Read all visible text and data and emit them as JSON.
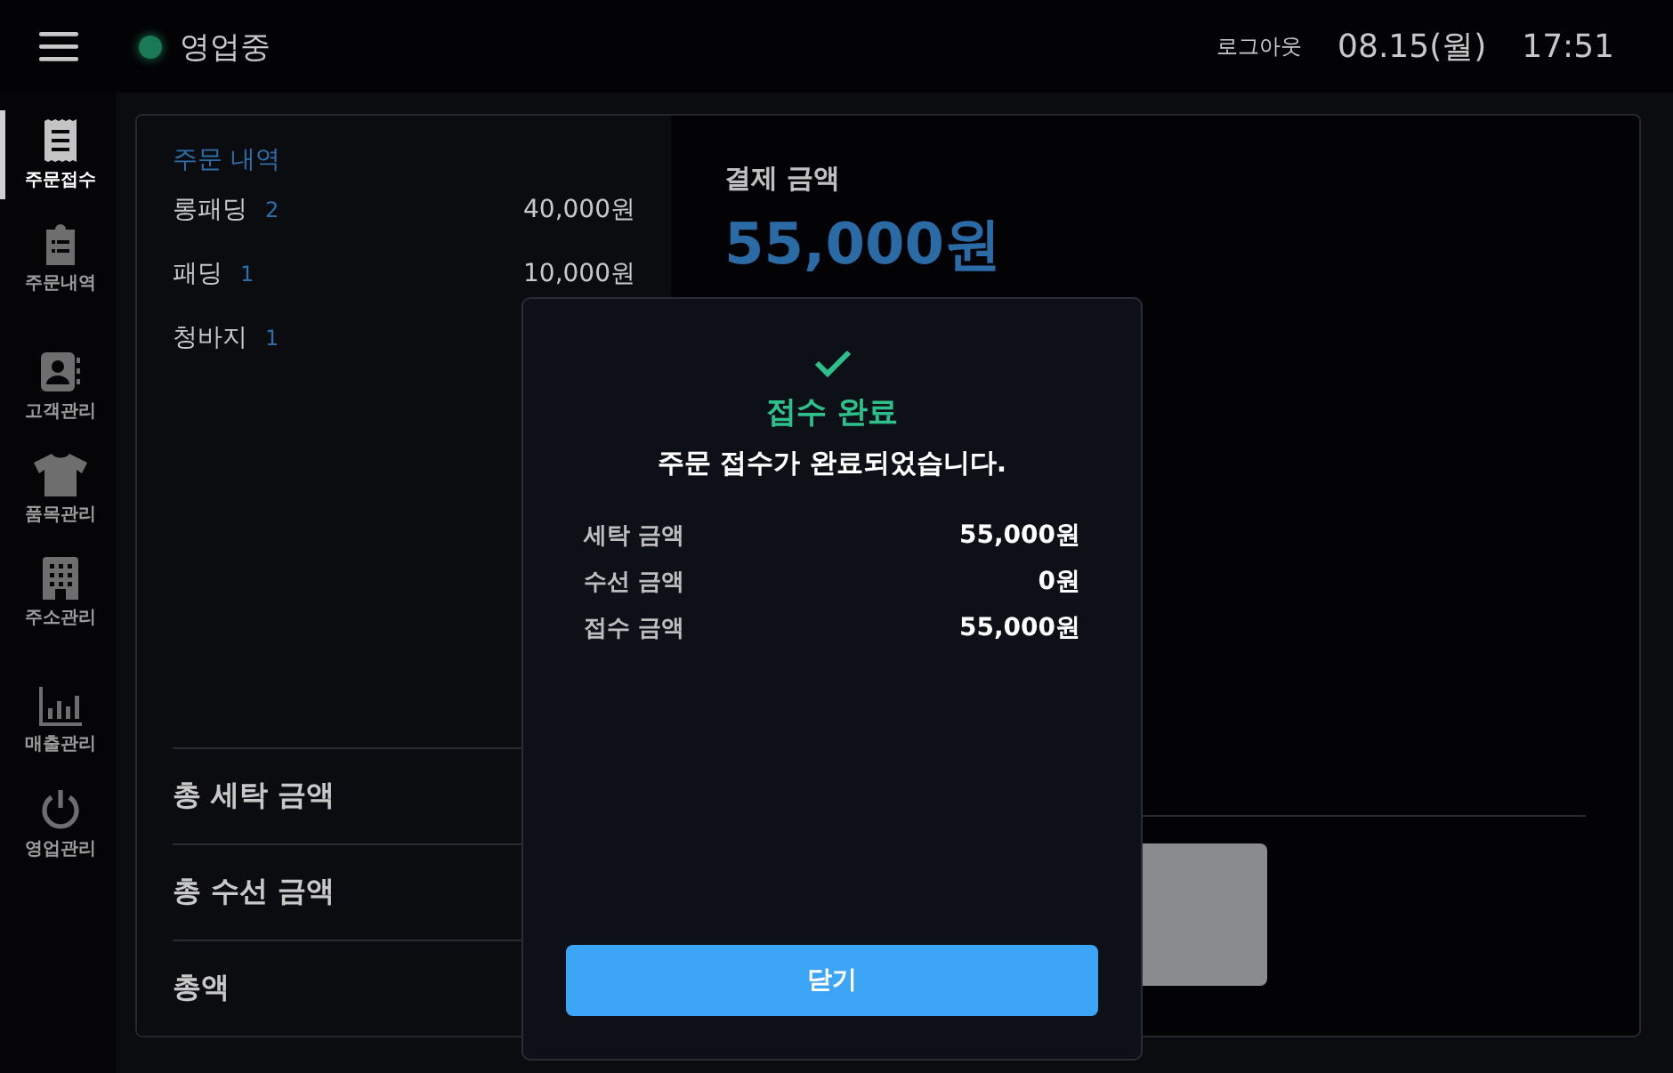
{
  "header": {
    "status": {
      "label": "영업중",
      "on": true
    },
    "logout": "로그아웃",
    "date": "08.15(월)",
    "time": "17:51"
  },
  "sidebar": {
    "groups": [
      {
        "items": [
          {
            "label": "주문접수",
            "kind": "receipt",
            "selected": true
          },
          {
            "label": "주문내역",
            "kind": "clipboard",
            "selected": false
          }
        ]
      },
      {
        "items": [
          {
            "label": "고객관리",
            "kind": "contact",
            "selected": false
          },
          {
            "label": "품목관리",
            "kind": "shirt",
            "selected": false
          },
          {
            "label": "주소관리",
            "kind": "building",
            "selected": false
          }
        ]
      },
      {
        "items": [
          {
            "label": "매출관리",
            "kind": "chart",
            "selected": false
          },
          {
            "label": "영업관리",
            "kind": "power",
            "selected": false
          }
        ]
      }
    ]
  },
  "order_list": {
    "title": "주문 내역",
    "items": [
      {
        "name": "롱패딩",
        "quantity": "2",
        "price": "40,000원"
      },
      {
        "name": "패딩",
        "quantity": "1",
        "price": "10,000원"
      },
      {
        "name": "청바지",
        "quantity": "1"
      }
    ],
    "totals": [
      "총 세탁 금액",
      "총 수선 금액",
      "총액"
    ]
  },
  "payment": {
    "label": "결제 금액",
    "amount": "55,000원"
  },
  "dialog": {
    "title": "접수 완료",
    "message": "주문 접수가 완료되었습니다.",
    "rows": [
      {
        "label": "세탁 금액",
        "value": "55,000원"
      },
      {
        "label": "수선 금액",
        "value": "0원"
      },
      {
        "label": "접수 금액",
        "value": "55,000원"
      }
    ],
    "button": "닫기"
  }
}
